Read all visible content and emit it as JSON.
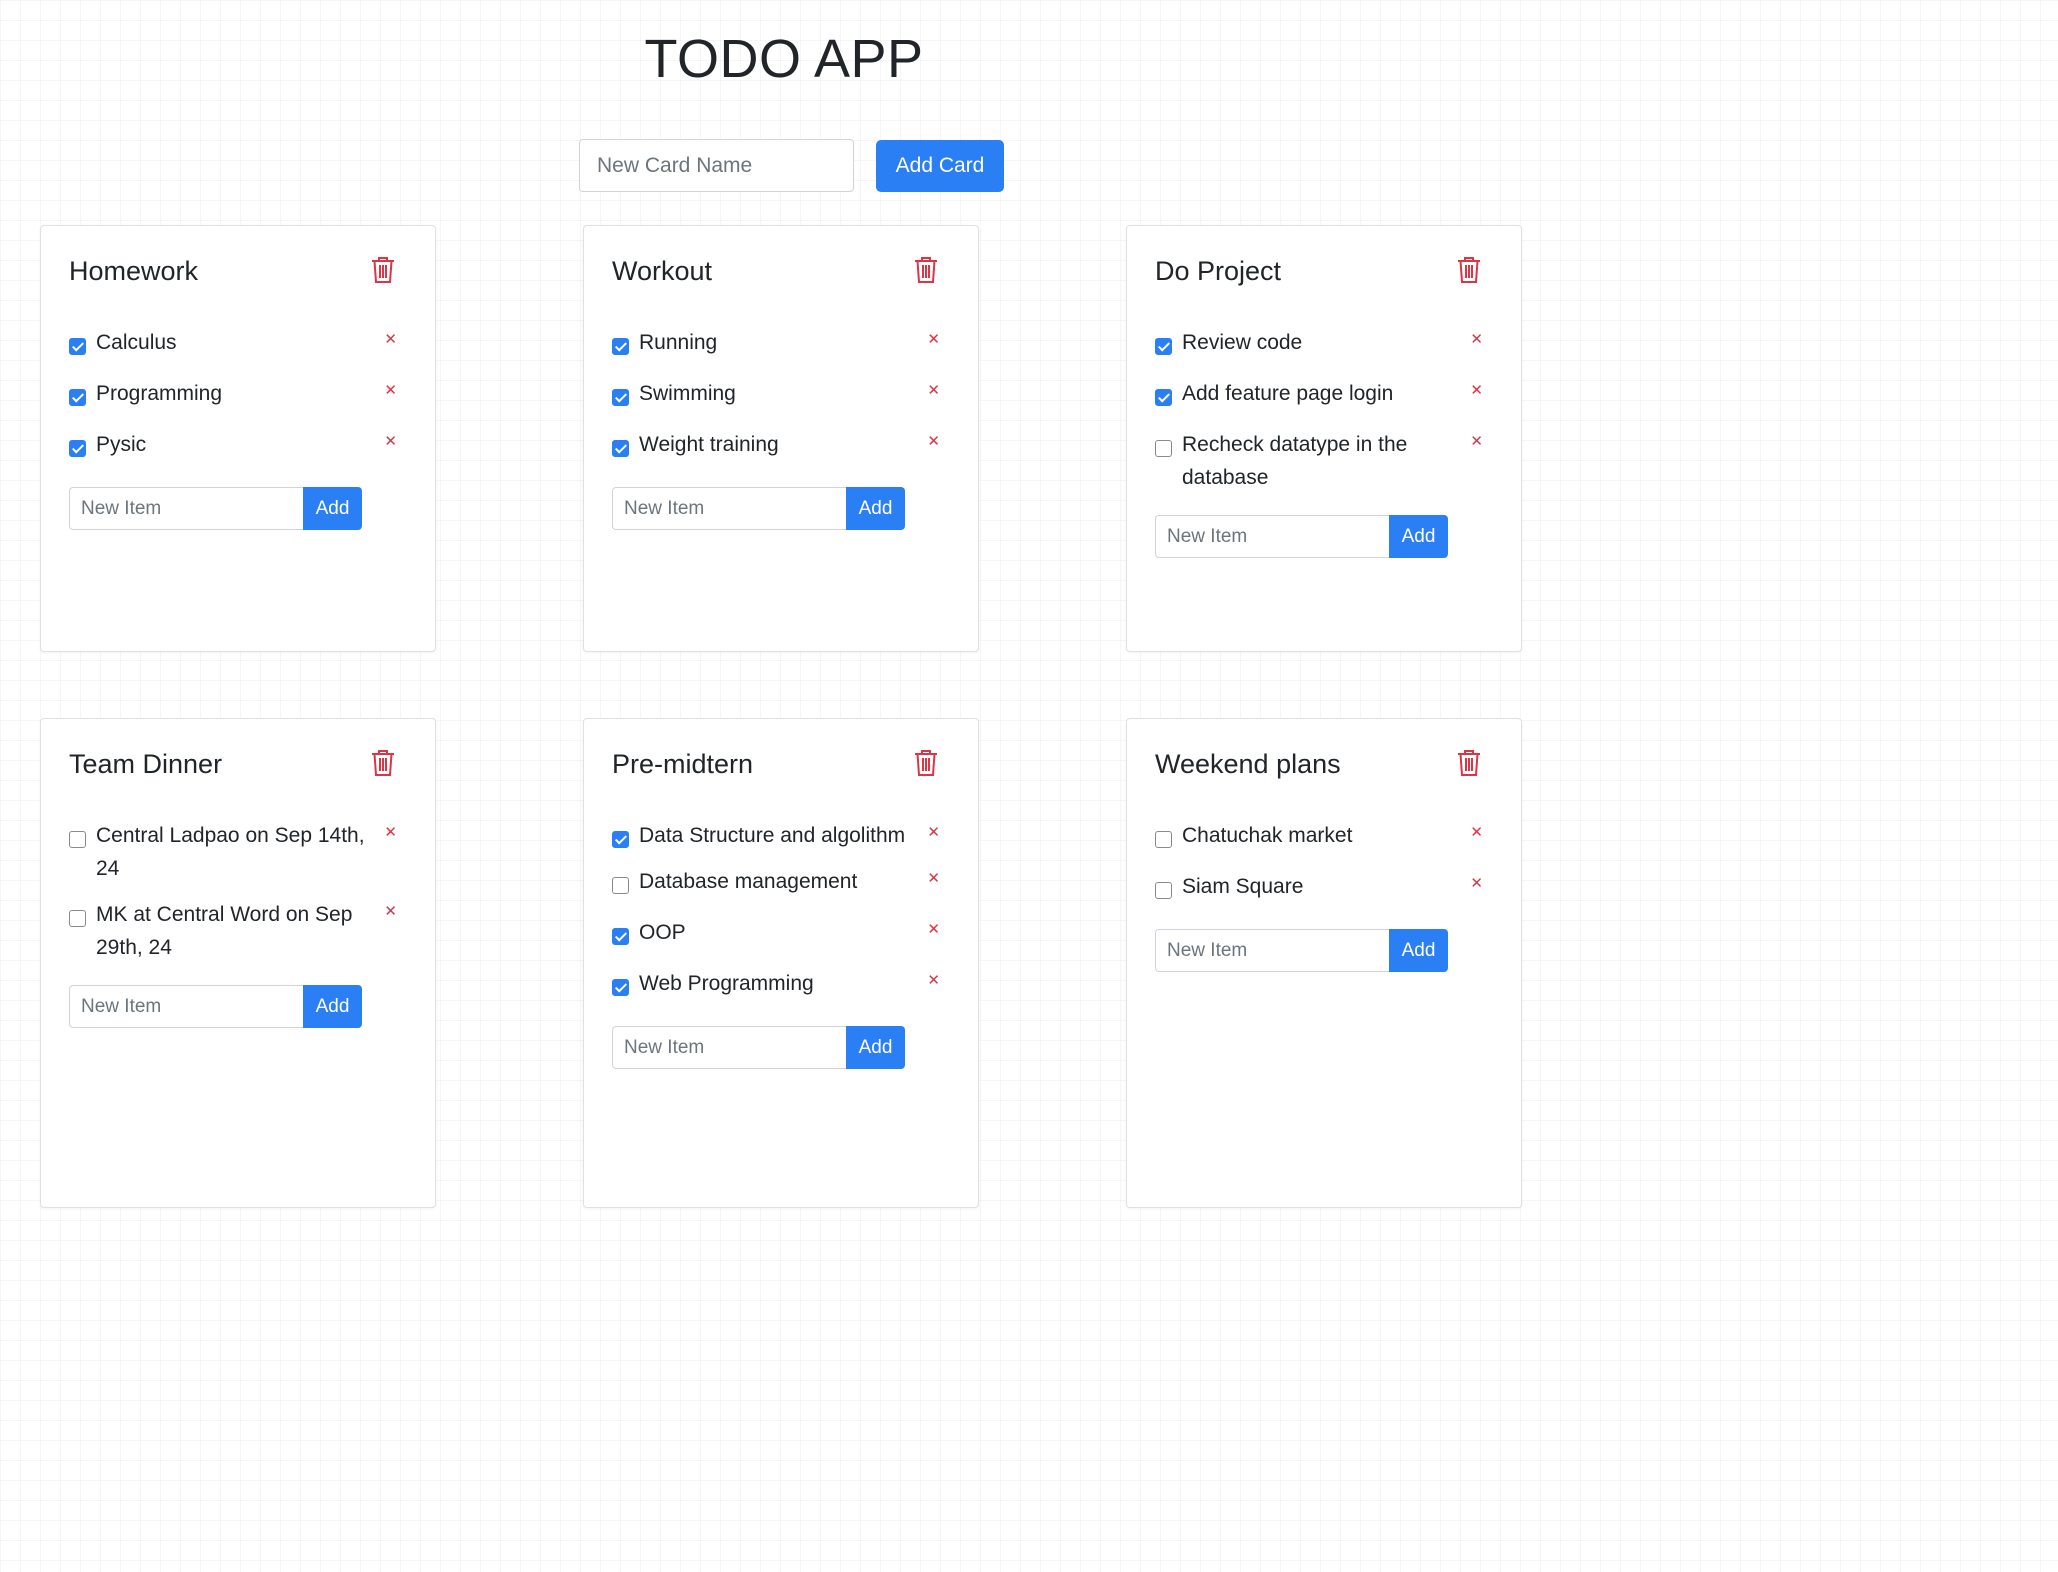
{
  "app": {
    "title": "TODO APP"
  },
  "add_card": {
    "placeholder": "New Card Name",
    "button_label": "Add Card"
  },
  "new_item": {
    "placeholder": "New Item",
    "button_label": "Add"
  },
  "colors": {
    "primary": "#2b7ff4",
    "danger": "#dc3545"
  },
  "icons": {
    "delete_card": "trash-icon",
    "remove_item": "close-icon"
  },
  "cards": [
    {
      "title": "Homework",
      "items": [
        {
          "text": "Calculus",
          "checked": true
        },
        {
          "text": "Programming",
          "checked": true
        },
        {
          "text": "Pysic",
          "checked": true
        }
      ]
    },
    {
      "title": "Workout",
      "items": [
        {
          "text": "Running",
          "checked": true
        },
        {
          "text": "Swimming",
          "checked": true
        },
        {
          "text": "Weight training",
          "checked": true
        }
      ]
    },
    {
      "title": "Do Project",
      "items": [
        {
          "text": "Review code",
          "checked": true
        },
        {
          "text": "Add feature page login",
          "checked": true
        },
        {
          "text": "Recheck datatype in the database",
          "checked": false
        }
      ]
    },
    {
      "title": "Team Dinner",
      "items": [
        {
          "text": "Central Ladpao on Sep 14th, 24",
          "checked": false
        },
        {
          "text": "MK at Central Word on Sep 29th, 24",
          "checked": false
        }
      ]
    },
    {
      "title": "Pre-midtern",
      "items": [
        {
          "text": "Data Structure and algolithm",
          "checked": true
        },
        {
          "text": "Database management",
          "checked": false
        },
        {
          "text": "OOP",
          "checked": true
        },
        {
          "text": "Web Programming",
          "checked": true
        }
      ]
    },
    {
      "title": "Weekend plans",
      "items": [
        {
          "text": "Chatuchak market",
          "checked": false
        },
        {
          "text": "Siam Square",
          "checked": false
        }
      ]
    }
  ]
}
